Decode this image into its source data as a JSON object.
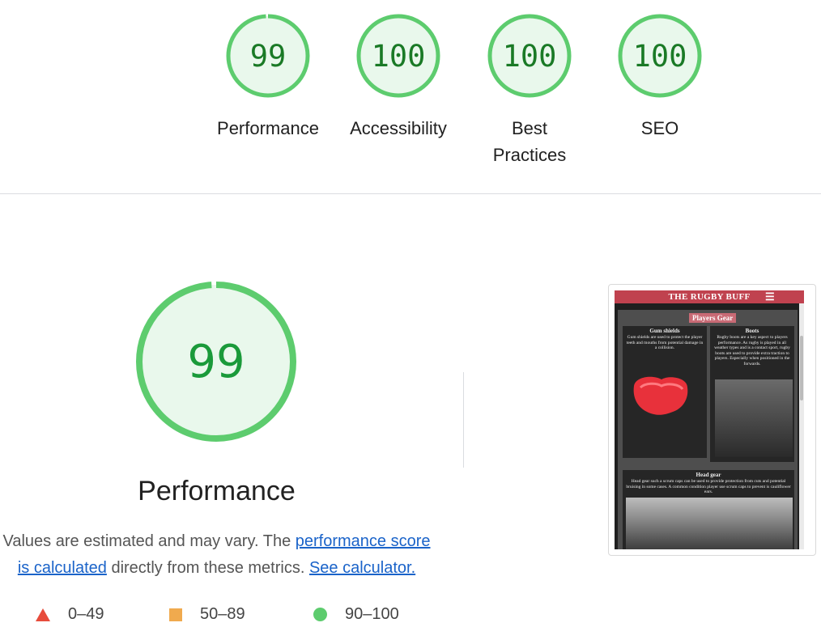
{
  "categories": [
    {
      "label": "Performance",
      "score": "99",
      "value": 99
    },
    {
      "label": "Accessibility",
      "score": "100",
      "value": 100
    },
    {
      "label": "Best Practices",
      "score": "100",
      "value": 100
    },
    {
      "label": "SEO",
      "score": "100",
      "value": 100
    }
  ],
  "main": {
    "score": "99",
    "value": 99,
    "title": "Performance",
    "desc_prefix": "Values are estimated and may vary. The ",
    "link_score": "performance score is calculated",
    "desc_middle": " directly from these metrics. ",
    "link_calc": "See calculator."
  },
  "legend": [
    {
      "range": "0–49",
      "shape": "triangle",
      "color": "#e74c3c"
    },
    {
      "range": "50–89",
      "shape": "square",
      "color": "#f0aa4e"
    },
    {
      "range": "90–100",
      "shape": "circle",
      "color": "#5dcc6e"
    }
  ],
  "screenshot": {
    "site_title": "THE RUGBY BUFF",
    "menu_icon": "☰",
    "section": "Players Gear",
    "card1_title": "Gum shields",
    "card1_text": "Gum shields are used to protect the player teeth and mouths from potential damage in a collision.",
    "card2_title": "Boots",
    "card2_text": "Rugby boots are a key aspect to players performance. As rugby is played in all weather types and is a contact sport, rugby boots are used to provide extra traction to players. Especially when positioned in the forwards.",
    "card3_title": "Head gear",
    "card3_text": "Head gear such a scrum caps can be used to provide protection from cuts and potential bruising in some cases. A common condition player use scrum caps to prevent is cauliflower ears."
  },
  "colors": {
    "pass": "#0cce6b",
    "pass_fill": "#e9f8ec",
    "pass_text": "#1a7a26",
    "link": "#1a63c9"
  }
}
